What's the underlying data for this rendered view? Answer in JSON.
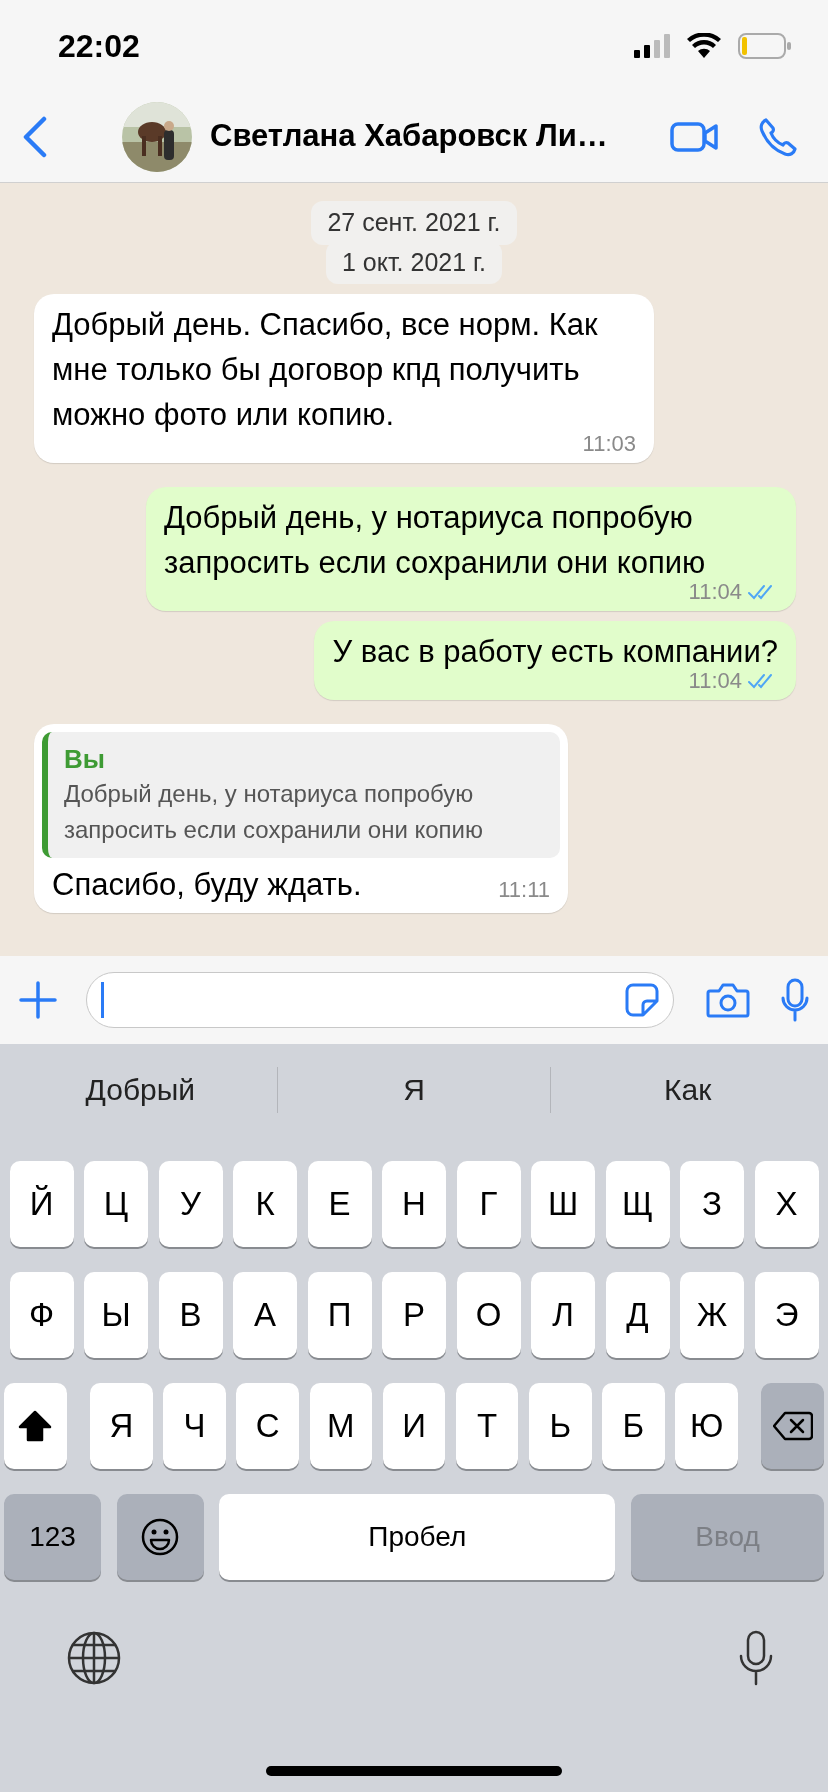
{
  "status_bar": {
    "time": "22:02"
  },
  "header": {
    "contact_name": "Светлана Хабаровск Ли…"
  },
  "date_chips": [
    "27 сент. 2021 г.",
    "1 окт. 2021 г."
  ],
  "messages": [
    {
      "kind": "incoming",
      "text": "Добрый день. Спасибо, все норм. Как мне только бы договор кпд получить можно фото или копию.",
      "time": "11:03"
    },
    {
      "kind": "outgoing",
      "text": "Добрый день, у нотариуса попробую запросить если сохранили они копию",
      "time": "11:04",
      "read": true
    },
    {
      "kind": "outgoing",
      "text": "У вас в работу есть компании?",
      "time": "11:04",
      "read": true
    },
    {
      "kind": "incoming",
      "text": "Спасибо, буду ждать.",
      "time": "11:11",
      "reply_to": {
        "author": "Вы",
        "text": "Добрый день, у нотариуса попробую запросить если сохранили они копию"
      }
    }
  ],
  "suggestions": [
    "Добрый",
    "Я",
    "Как"
  ],
  "keyboard": {
    "top_row": [
      "Й",
      "Ц",
      "У",
      "К",
      "Е",
      "Н",
      "Г",
      "Ш",
      "Щ",
      "З",
      "Х"
    ],
    "middle_row": [
      "Ф",
      "Ы",
      "В",
      "А",
      "П",
      "Р",
      "О",
      "Л",
      "Д",
      "Ж",
      "Э"
    ],
    "shift_row": [
      "Я",
      "Ч",
      "С",
      "М",
      "И",
      "Т",
      "Ь",
      "Б",
      "Ю"
    ],
    "shift_on": true,
    "numbers_key": "123",
    "space_key": "Пробел",
    "return_key": {
      "label": "Ввод",
      "disabled": true
    }
  }
}
